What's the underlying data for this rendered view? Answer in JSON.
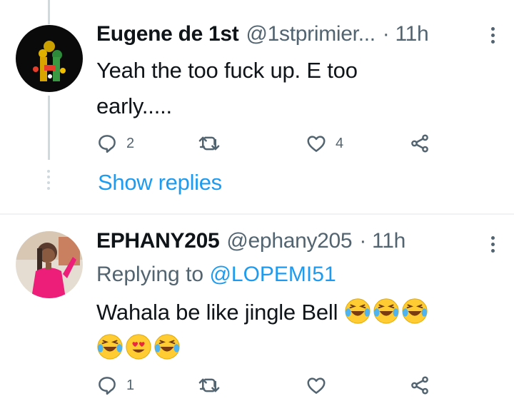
{
  "tweets": [
    {
      "name": "Eugene de 1st",
      "handle": "@1stprimier...",
      "separator": "·",
      "time": "11h",
      "text": "Yeah the too fuck up. E too early.....",
      "replies": "2",
      "retweets": "",
      "likes": "4"
    },
    {
      "name": "EPHANY205",
      "handle": "@ephany205",
      "separator": "·",
      "time": "11h",
      "replying_prefix": "Replying to ",
      "replying_to": "@LOPEMI51",
      "text": "Wahala be like jingle Bell",
      "emojis": [
        "laughing-crying",
        "laughing-crying",
        "laughing-crying",
        "laughing-crying",
        "heart-eyes",
        "laughing-crying"
      ],
      "replies": "1",
      "retweets": "",
      "likes": ""
    }
  ],
  "show_replies": "Show replies",
  "icons": {
    "reply": "reply-icon",
    "retweet": "retweet-icon",
    "like": "heart-icon",
    "share": "share-icon",
    "more": "more-icon"
  },
  "colors": {
    "link": "#1d9bf0",
    "muted": "#536471",
    "text": "#0f1419",
    "thread_line": "#cfd9de"
  }
}
